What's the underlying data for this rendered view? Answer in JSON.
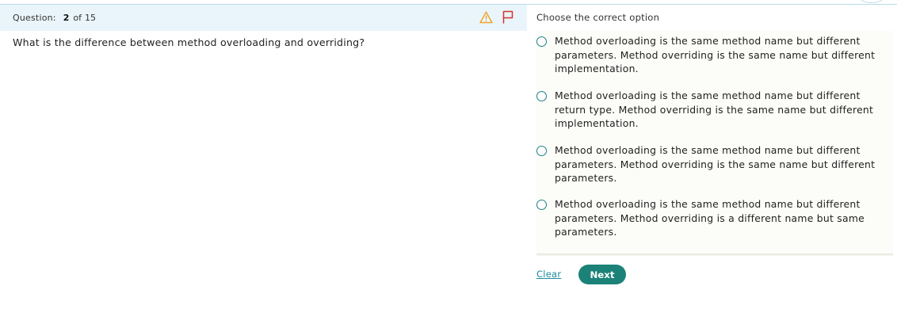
{
  "header": {
    "question_label": "Question:",
    "current": "2",
    "of_label": "of",
    "total": "15"
  },
  "question": {
    "text": "What is the difference between method overloading and overriding?"
  },
  "answers": {
    "instruction": "Choose the correct option",
    "options": [
      {
        "label": "Method overloading is the same method name but different parameters. Method overriding is the same name but different implementation."
      },
      {
        "label": "Method overloading is the same method name but different return type. Method overriding is the same name but different implementation."
      },
      {
        "label": "Method overloading is the same method name but different parameters. Method overriding is the same name but different parameters."
      },
      {
        "label": "Method overloading is the same method name but different parameters. Method overriding is a different name but same parameters."
      }
    ]
  },
  "actions": {
    "clear_label": "Clear",
    "next_label": "Next"
  },
  "icons": {
    "warning": "warning-icon",
    "flag": "flag-icon"
  },
  "colors": {
    "header_bg": "#eaf5fb",
    "accent": "#1c8278",
    "warning": "#f0a020",
    "flag": "#d2332a",
    "link": "#1f8aa0"
  }
}
